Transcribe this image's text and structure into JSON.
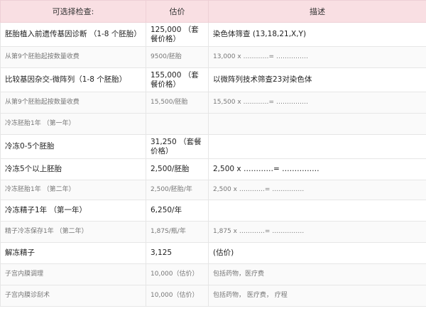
{
  "header": {
    "col1": "可选择检查:",
    "col2": "估价",
    "col3": "描述"
  },
  "rows": [
    {
      "item": "胚胎植入前遗传基因诊断 （1-8 个胚胎）",
      "price": "125,000 （套餐价格）",
      "desc": "染色体筛查 (13,18,21,X,Y)"
    },
    {
      "item": "从第9个胚胎起按数量收费",
      "price": "9500/胚胎",
      "desc": "13,000 x …………= ……………"
    },
    {
      "item": "比较基因杂交-微阵列（1-8 个胚胎）",
      "price": "155,000 （套餐价格）",
      "desc": "以微阵列技术筛查23对染色体"
    },
    {
      "item": "从第9个胚胎起按数量收费",
      "price": "15,500/胚胎",
      "desc": "15,500 x …………= ……………"
    },
    {
      "item": "冷冻胚胎1年 （第一年）",
      "price": "",
      "desc": ""
    },
    {
      "item": "冷冻0-5个胚胎",
      "price": "31,250 （套餐价格）",
      "desc": ""
    },
    {
      "item": "冷冻5个以上胚胎",
      "price": "2,500/胚胎",
      "desc": "2,500 x …………= ……………"
    },
    {
      "item": "冷冻胚胎1年 （第二年）",
      "price": "2,500/胚胎/年",
      "desc": "2,500 x …………= ……………"
    },
    {
      "item": "冷冻精子1年 （第一年）",
      "price": "6,250/年",
      "desc": ""
    },
    {
      "item": "精子冷冻保存1年 （第二年）",
      "price": "1,87S/瓶/年",
      "desc": "1,875 x …………= ……………"
    },
    {
      "item": "解冻精子",
      "price": "3,125",
      "desc": "(估价)"
    },
    {
      "item": "子宫内膜调理",
      "price": "10,000（估价）",
      "desc": "包括药物，医疗费"
    },
    {
      "item": "子宫内膜诊刮术",
      "price": "10,000（估价）",
      "desc": "包括药物， 医疗费， 疗程"
    }
  ]
}
